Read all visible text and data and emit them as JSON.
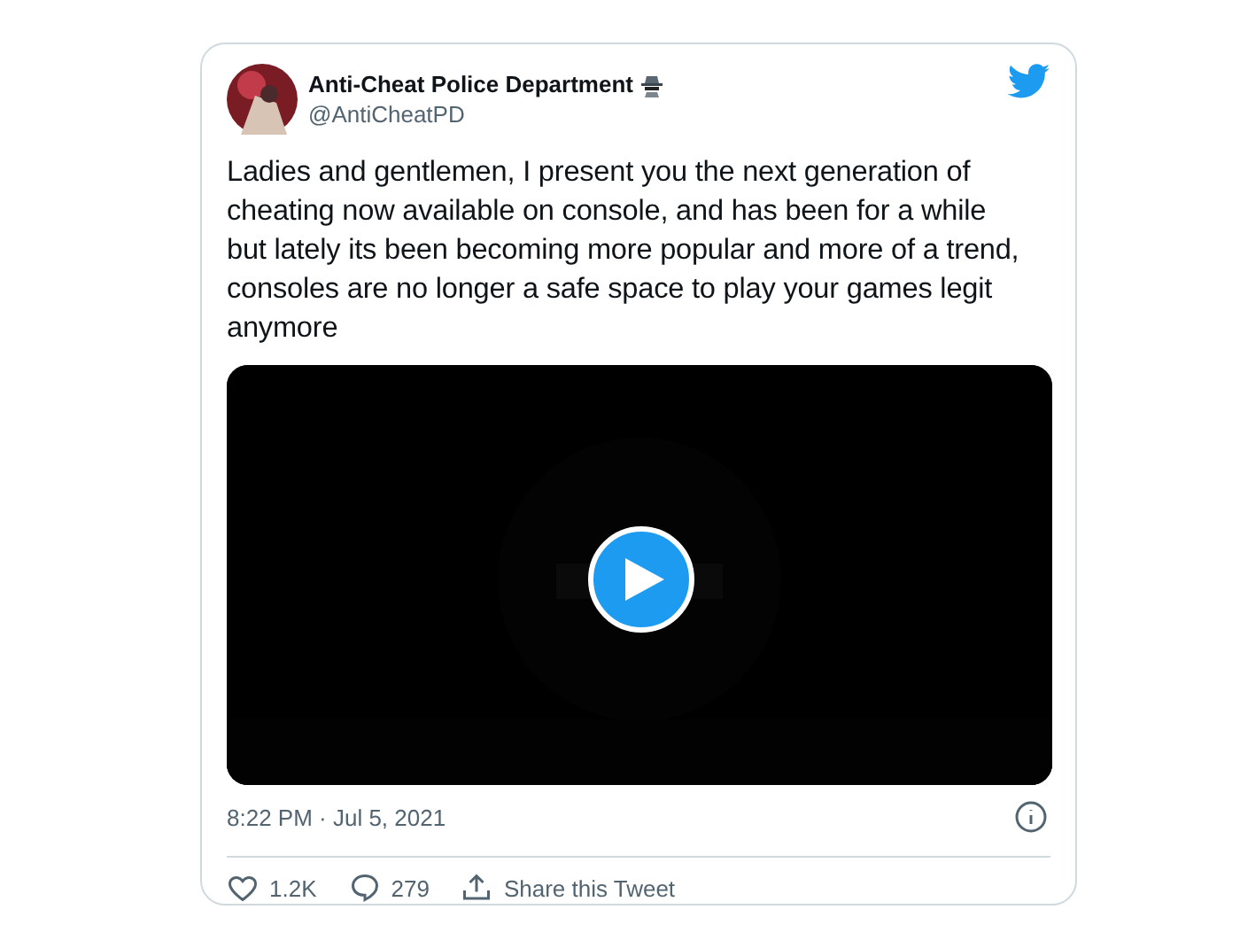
{
  "tweet": {
    "author": {
      "name": "Anti-Cheat Police Department",
      "handle": "@AntiCheatPD"
    },
    "text": "Ladies and gentlemen, I present you the next generation of cheating now available on console, and has been for a while but lately its been becoming more popular and more of a trend, consoles are no longer a safe space to play your games legit anymore",
    "timestamp": "8:22 PM · Jul 5, 2021",
    "actions": [
      {
        "kind": "like",
        "label": "1.2K"
      },
      {
        "kind": "reply",
        "label": "279"
      },
      {
        "kind": "share",
        "label": "Share this Tweet"
      }
    ]
  }
}
